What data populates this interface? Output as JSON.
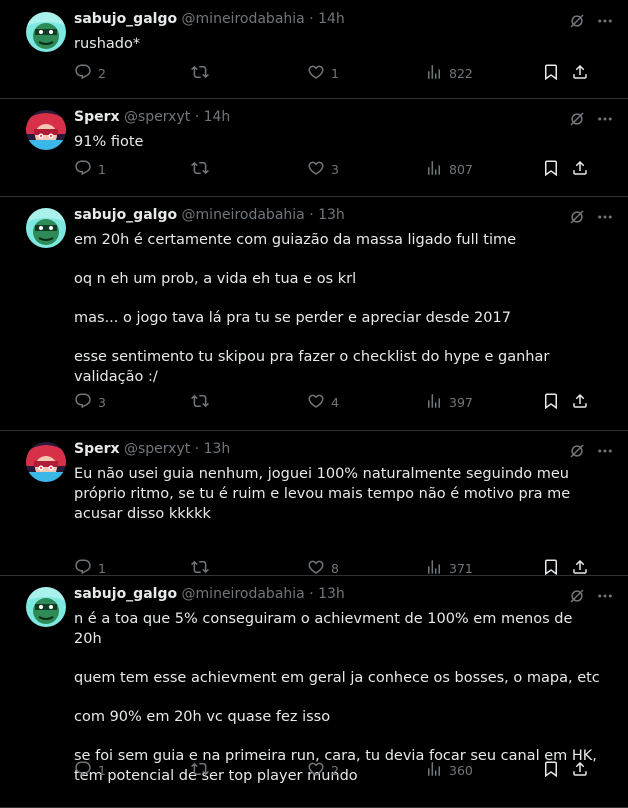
{
  "tweets": [
    {
      "name": "sabujo_galgo",
      "handle": "@mineirodabahia",
      "time": "14h",
      "lines": [
        "rushado*"
      ],
      "replies": "2",
      "retweets": "",
      "likes": "1",
      "views": "822",
      "avatar": "avatar-green"
    },
    {
      "name": "Sperx",
      "handle": "@sperxyt",
      "time": "14h",
      "lines": [
        "91% fiote"
      ],
      "replies": "1",
      "retweets": "",
      "likes": "3",
      "views": "807",
      "avatar": "avatar-red"
    },
    {
      "name": "sabujo_galgo",
      "handle": "@mineirodabahia",
      "time": "13h",
      "lines": [
        "em 20h é certamente com guiazão da massa ligado full time",
        "oq n eh um prob, a vida eh tua e os krl",
        "mas... o jogo tava lá pra tu se perder e apreciar desde 2017",
        "esse sentimento tu skipou pra fazer o checklist do hype e ganhar validação :/"
      ],
      "replies": "3",
      "retweets": "",
      "likes": "4",
      "views": "397",
      "avatar": "avatar-green"
    },
    {
      "name": "Sperx",
      "handle": "@sperxyt",
      "time": "13h",
      "lines": [
        "Eu não usei guia nenhum, joguei 100% naturalmente seguindo meu próprio ritmo, se tu é ruim e levou mais tempo não é motivo pra me acusar disso kkkkk"
      ],
      "replies": "1",
      "retweets": "",
      "likes": "8",
      "views": "371",
      "avatar": "avatar-red"
    },
    {
      "name": "sabujo_galgo",
      "handle": "@mineirodabahia",
      "time": "13h",
      "lines": [
        "n é a toa que 5% conseguiram o achievment de 100% em menos de 20h",
        "quem tem esse achievment em geral ja conhece os bosses, o mapa, etc",
        "com 90% em 20h vc quase fez isso",
        "se foi sem guia e na primeira run, cara, tu devia focar seu canal em HK, tem potencial de ser top player mundo"
      ],
      "replies": "1",
      "retweets": "",
      "likes": "2",
      "views": "360",
      "avatar": "avatar-green"
    }
  ],
  "separator": "·",
  "colors": {
    "background": "#000000",
    "text": "#e7e9ea",
    "muted": "#71767b",
    "divider": "#2f3336"
  }
}
